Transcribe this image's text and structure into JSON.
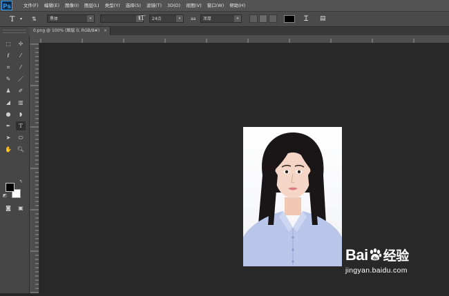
{
  "app": {
    "logo": "Ps"
  },
  "menu": [
    "文件(F)",
    "编辑(E)",
    "图像(I)",
    "图层(L)",
    "类型(Y)",
    "选择(S)",
    "滤镜(T)",
    "3D(D)",
    "视图(V)",
    "窗口(W)",
    "帮助(H)"
  ],
  "options": {
    "tool_glyph": "T",
    "font_family": "黑体",
    "font_style": "-",
    "font_size": "24点",
    "aa_label": "aa",
    "antialias": "浑厚",
    "text_color": "#000000"
  },
  "document": {
    "tab_title": "0.png @ 100% (图层 0, RGB/8#)",
    "close_glyph": "×"
  },
  "tools": {
    "foreground_color": "#000000",
    "background_color": "#ffffff",
    "items": [
      "marquee-icon",
      "move-icon",
      "lasso-icon",
      "magic-wand-icon",
      "crop-icon",
      "eyedropper-icon",
      "healing-icon",
      "brush-icon",
      "stamp-icon",
      "history-brush-icon",
      "eraser-icon",
      "gradient-icon",
      "blur-icon",
      "dodge-icon",
      "pen-icon",
      "type-icon",
      "path-select-icon",
      "shape-icon",
      "hand-icon",
      "zoom-icon"
    ]
  },
  "watermark": {
    "brand_latin": "Bai",
    "brand_suffix": "du",
    "brand_cn": "经验",
    "url": "jingyan.baidu.com"
  },
  "colors": {
    "menubar": "#535353",
    "workspace": "#282828",
    "shirt": "#b9c6ea",
    "hair": "#1a1618"
  }
}
